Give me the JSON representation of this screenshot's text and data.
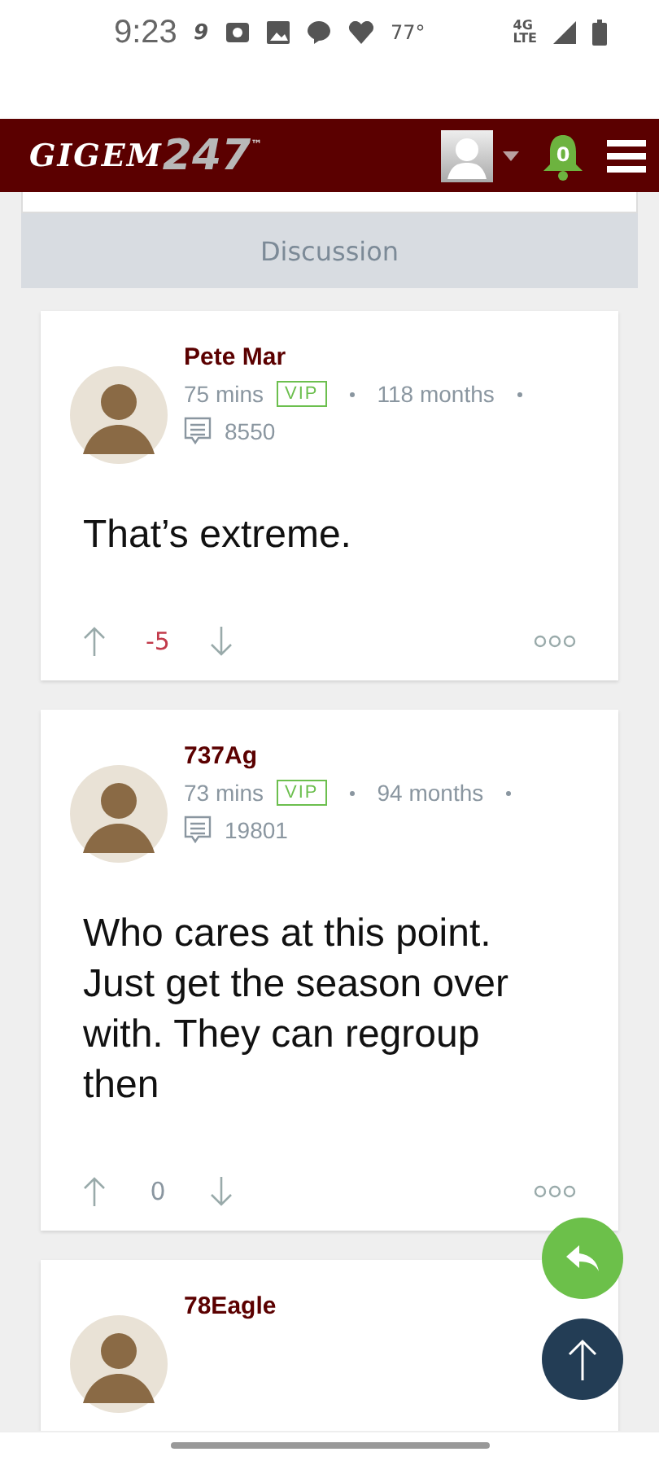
{
  "status_bar": {
    "time": "9:23",
    "app_glyph": "9",
    "temperature": "77°",
    "network_top": "4G",
    "network_bottom": "LTE"
  },
  "header": {
    "logo_word": "GIGEM",
    "logo_number": "247",
    "logo_mark": "™",
    "notification_count": "0"
  },
  "section": {
    "title": "Discussion"
  },
  "posts": [
    {
      "author": "Pete Mar",
      "age": "75 mins",
      "badge": "VIP",
      "tenure": "118 months",
      "post_count": "8550",
      "body": "That’s extreme.",
      "score": "-5",
      "color": "#c23a4a"
    },
    {
      "author": "737Ag",
      "age": "73 mins",
      "badge": "VIP",
      "tenure": "94 months",
      "post_count": "19801",
      "body": "Who cares at this point. Just get the season over with. They can regroup then",
      "score": "0",
      "color": "#8a96a0"
    },
    {
      "author": "78Eagle"
    }
  ]
}
